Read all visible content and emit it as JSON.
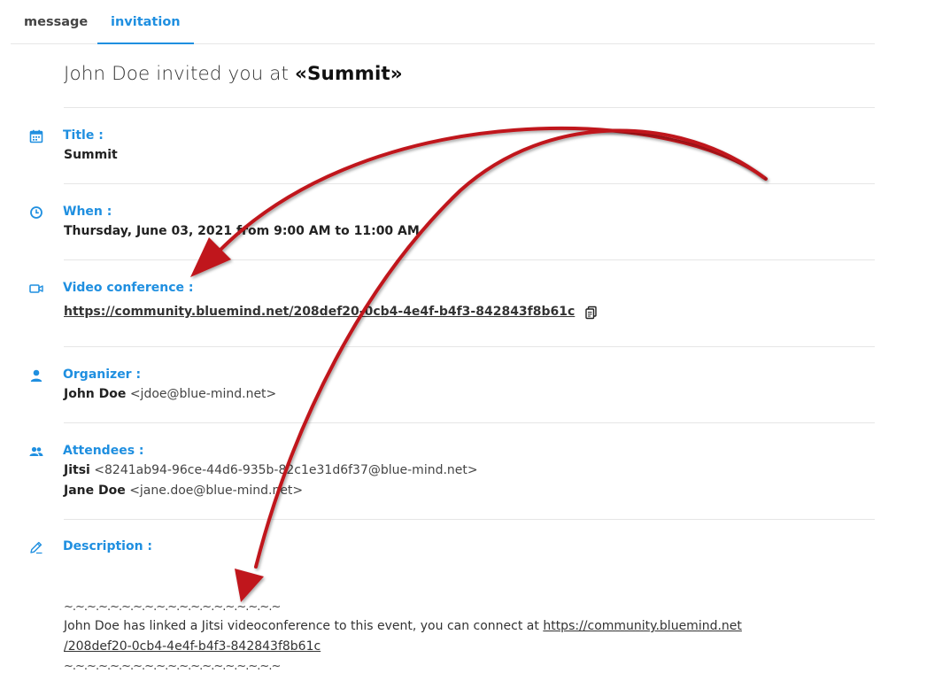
{
  "tabs": [
    {
      "label": "message",
      "active": false
    },
    {
      "label": "invitation",
      "active": true
    }
  ],
  "headline": {
    "prefix": "John Doe invited you at ",
    "event": "«Summit»"
  },
  "title": {
    "label": "Title :",
    "value": "Summit"
  },
  "when": {
    "label": "When :",
    "value": "Thursday, June 03, 2021 from 9:00 AM to 11:00 AM"
  },
  "video": {
    "label": "Video conference :",
    "url": "https://community.bluemind.net/208def20-0cb4-4e4f-b4f3-842843f8b61c",
    "copy_icon": "copy-icon"
  },
  "organizer": {
    "label": "Organizer :",
    "name": "John Doe",
    "email": "<jdoe@blue-mind.net>"
  },
  "attendees": {
    "label": "Attendees :",
    "items": [
      {
        "name": "Jitsi",
        "email": "<8241ab94-96ce-44d6-935b-82c1e31d6f37@blue-mind.net>"
      },
      {
        "name": "Jane Doe",
        "email": "<jane.doe@blue-mind.net>"
      }
    ]
  },
  "description": {
    "label": "Description :",
    "separator": "~.~.~.~.~.~.~.~.~.~.~.~.~.~.~.~.~.~.~",
    "text": "John Doe has linked a Jitsi videoconference to this event, you can connect at ",
    "link_part1": "https://community.bluemind.net",
    "link_part2": "/208def20-0cb4-4e4f-b4f3-842843f8b61c"
  },
  "colors": {
    "accent": "#1f8fe0",
    "arrow": "#c0151b"
  }
}
